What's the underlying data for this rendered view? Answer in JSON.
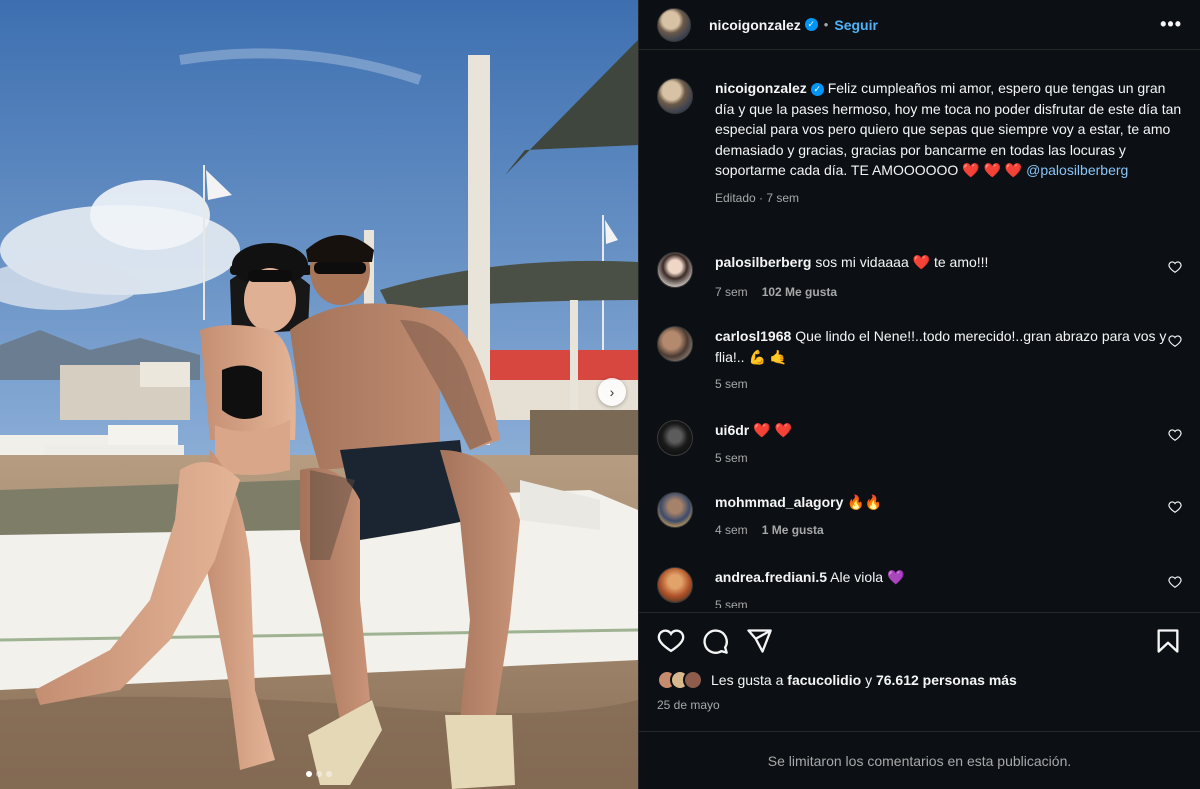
{
  "post": {
    "carousel": {
      "count": 3,
      "active": 0,
      "next_label": "›"
    }
  },
  "header": {
    "username": "nicoigonzalez",
    "separator": "•",
    "follow_label": "Seguir",
    "more_label": "•••"
  },
  "caption": {
    "username": "nicoigonzalez",
    "text": "Feliz cumpleaños mi amor, espero que tengas un gran día y que la pases hermoso, hoy me toca no poder disfrutar de este día tan especial para vos pero quiero que sepas que siempre voy a estar, te amo demasiado y gracias, gracias por bancarme en todas las locuras y soportarme cada día. TE AMOOOOOO",
    "emoji": "❤️ ❤️ ❤️",
    "mention": "@palosilberberg",
    "meta": "Editado · 7 sem"
  },
  "comments": [
    {
      "username": "palosilberberg",
      "text": "sos mi vidaaaa",
      "emoji_mid": "❤️",
      "text_after": "te amo!!!",
      "time": "7 sem",
      "likes": "102 Me gusta"
    },
    {
      "username": "carlosl1968",
      "text": "Que lindo el Nene!!..todo merecido!..gran abrazo para vos y flia!..",
      "emoji_mid": "💪 🤙",
      "text_after": "",
      "time": "5 sem",
      "likes": ""
    },
    {
      "username": "ui6dr",
      "text": "",
      "emoji_mid": "❤️ ❤️",
      "text_after": "",
      "time": "5 sem",
      "likes": ""
    },
    {
      "username": "mohmmad_alagory",
      "text": "",
      "emoji_mid": "🔥🔥",
      "text_after": "",
      "time": "4 sem",
      "likes": "1 Me gusta"
    },
    {
      "username": "andrea.frediani.5",
      "text": "Ale viola",
      "emoji_mid": "💜",
      "text_after": "",
      "time": "5 sem",
      "likes": ""
    }
  ],
  "likes": {
    "prefix": "Les gusta a",
    "user": "facucolidio",
    "connector": "y",
    "count": "76.612 personas más"
  },
  "date": "25 de mayo",
  "limited_comments": "Se limitaron los comentarios en esta publicación.",
  "colors": {
    "panel_bg": "#0c1014",
    "link": "#4eb3f7",
    "muted": "#a8a8a8",
    "heart": "#ed4956"
  },
  "icons": [
    "verified-badge-icon",
    "more-options-icon",
    "heart-icon",
    "comment-icon",
    "share-icon",
    "bookmark-icon",
    "next-arrow-icon"
  ]
}
